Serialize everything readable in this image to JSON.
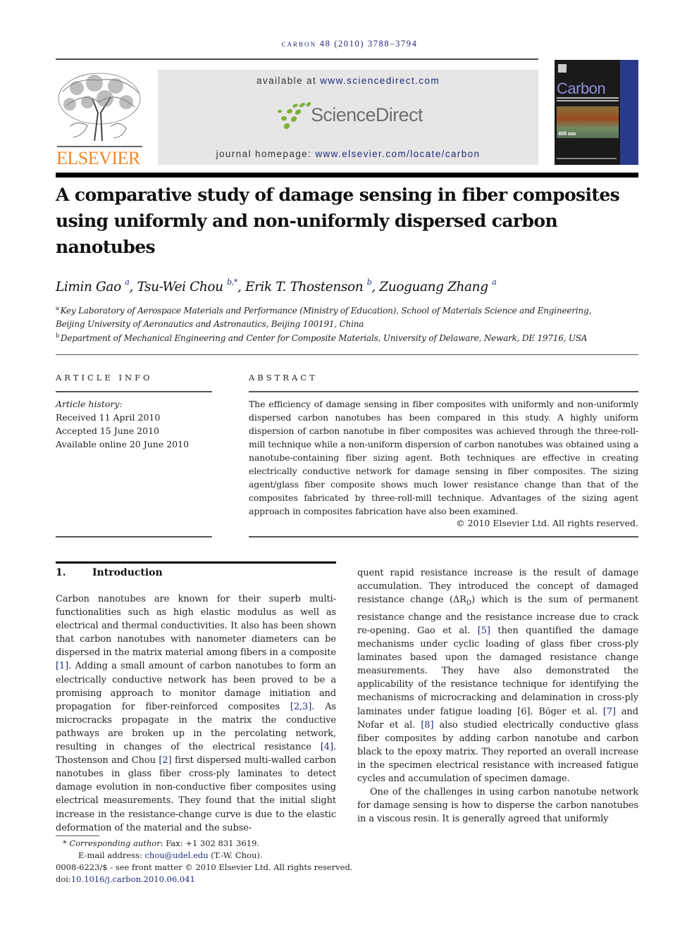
{
  "header": {
    "journal_name": "carbon",
    "citation": "48 (2010) 3788–3794",
    "publisher_logo_text": "ELSEVIER",
    "available_prefix": "available at ",
    "available_link": "www.sciencedirect.com",
    "sciencedirect_logo": "ScienceDirect",
    "homepage_prefix": "journal homepage: ",
    "homepage_link": "www.elsevier.com/locate/carbon",
    "cover": {
      "title": "Carbon",
      "scale_label": "400 nm"
    },
    "colors": {
      "link": "#1f2a7a",
      "elsevier_orange": "#f0882a",
      "sd_green": "#7fb03a",
      "cover_blue": "#2a3a8a"
    }
  },
  "article": {
    "title": "A comparative study of damage sensing in fiber composites using uniformly and non-uniformly dispersed carbon nanotubes",
    "authors": [
      {
        "name": "Limin Gao",
        "sup": "a"
      },
      {
        "name": "Tsu-Wei Chou",
        "sup": "b,*"
      },
      {
        "name": "Erik T. Thostenson",
        "sup": "b"
      },
      {
        "name": "Zuoguang Zhang",
        "sup": "a"
      }
    ],
    "affiliations": [
      {
        "key": "a",
        "line1": "Key Laboratory of Aerospace Materials and Performance (Ministry of Education), School of Materials Science and Engineering,",
        "line2": "Beijing University of Aeronautics and Astronautics, Beijing 100191, China"
      },
      {
        "key": "b",
        "line1": "Department of Mechanical Engineering and Center for Composite Materials, University of Delaware, Newark, DE 19716, USA"
      }
    ]
  },
  "article_info": {
    "label": "ARTICLE INFO",
    "history_label": "Article history:",
    "received": "Received 11 April 2010",
    "accepted": "Accepted 15 June 2010",
    "online": "Available online 20 June 2010"
  },
  "abstract": {
    "label": "ABSTRACT",
    "text": "The efficiency of damage sensing in fiber composites with uniformly and non-uniformly dispersed carbon nanotubes has been compared in this study. A highly uniform dispersion of carbon nanotube in fiber composites was achieved through the three-roll-mill technique while a non-uniform dispersion of carbon nanotubes was obtained using a nanotube-containing fiber sizing agent. Both techniques are effective in creating electrically conductive network for damage sensing in fiber composites. The sizing agent/glass fiber composite shows much lower resistance change than that of the composites fabricated by three-roll-mill technique. Advantages of the sizing agent approach in composites fabrication have also been examined.",
    "copyright": "© 2010 Elsevier Ltd. All rights reserved."
  },
  "introduction": {
    "number": "1.",
    "heading": "Introduction",
    "col1": {
      "t1": "Carbon nanotubes are known for their superb multi-functionalities such as high elastic modulus as well as electrical and thermal conductivities. It also has been shown that carbon nanotubes with nanometer diameters can be dispersed in the matrix material among fibers in a composite ",
      "r1": "[1]",
      "t2": ". Adding a small amount of carbon nanotubes to form an electrically conductive network has been proved to be a promising approach to monitor damage initiation and propagation for fiber-reinforced composites ",
      "r2": "[2,3]",
      "t3": ". As microcracks propagate in the matrix the conductive pathways are broken up in the percolating network, resulting in changes of the electrical resistance ",
      "r3": "[4]",
      "t4": ". Thostenson and Chou ",
      "r4": "[2]",
      "t5": " first dispersed multi-walled carbon nanotubes in glass fiber cross-ply laminates to detect damage evolution in non-conductive fiber composites using electrical measurements. They found that the initial slight increase in the resistance-change curve is due to the elastic deformation of the material and the subse-"
    },
    "col2": {
      "t1": "quent rapid resistance increase is the result of damage accumulation. They introduced the concept of damaged resistance change (ΔR",
      "sub": "D",
      "t2": ") which is the sum of permanent resistance change and the resistance increase due to crack re-opening. Gao et al. ",
      "r1": "[5]",
      "t3": " then quantified the damage mechanisms under cyclic loading of glass fiber cross-ply laminates based upon the damaged resistance change measurements. They have also demonstrated the applicability of the resistance technique for identifying the mechanisms of microcracking and delamination in cross-ply laminates under fatigue loading [6]. Böger et al. ",
      "r2": "[7]",
      "t4": " and Nofar et al. ",
      "r3": "[8]",
      "t5": " also studied electrically conductive glass fiber composites by adding carbon nanotube and carbon black to the epoxy matrix. They reported an overall increase in the specimen electrical resistance with increased fatigue cycles and accumulation of specimen damage.",
      "p2": "One of the challenges in using carbon nanotube network for damage sensing is how to disperse the carbon nanotubes in a viscous resin. It is generally agreed that uniformly"
    }
  },
  "footnotes": {
    "star": "*",
    "corr_label": "Corresponding author",
    "corr_text": ": Fax: +1 302 831 3619.",
    "email_prefix": "E-mail address: ",
    "email": "chou@udel.edu",
    "email_suffix": " (T.-W. Chou).",
    "issn_line": "0008-6223/$ - see front matter © 2010 Elsevier Ltd. All rights reserved.",
    "doi_prefix": "doi:",
    "doi": "10.1016/j.carbon.2010.06.041"
  }
}
